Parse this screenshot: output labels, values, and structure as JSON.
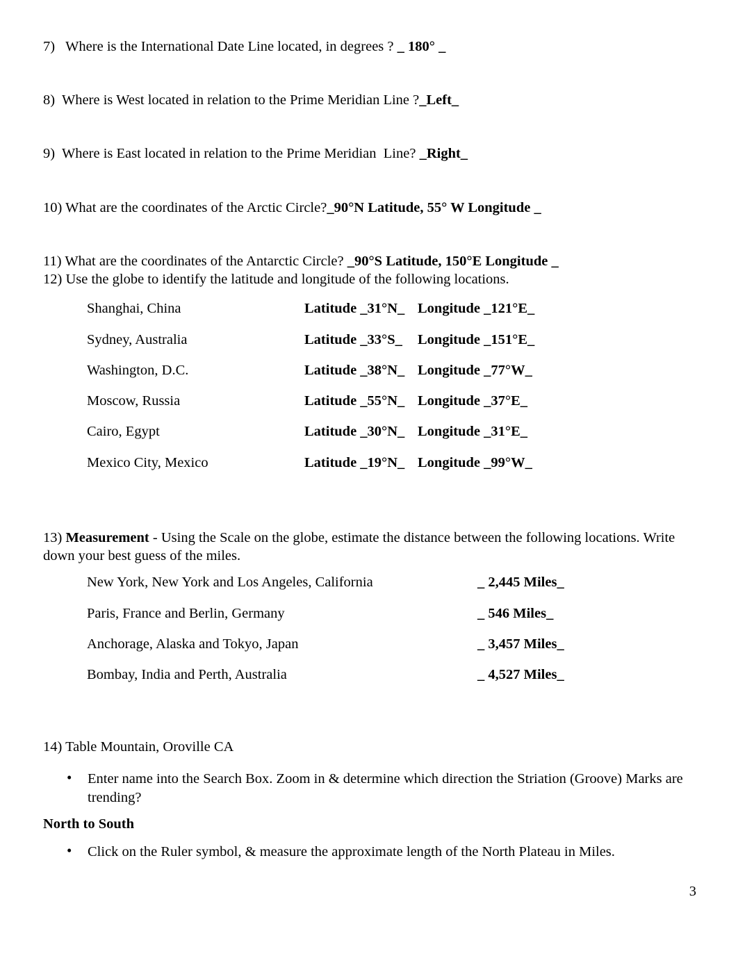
{
  "document": {
    "page_number": "3",
    "questions": [
      {
        "id": "q7",
        "prompt": "7)   Where is the International Date Line located, in degrees ? ",
        "answer": "_ 180° _"
      },
      {
        "id": "q8",
        "prompt": "8)  Where is West located in relation to the Prime Meridian Line ?",
        "answer": "_Left_"
      },
      {
        "id": "q9",
        "prompt": "9)  Where is East located in relation to the Prime Meridian  Line? ",
        "answer": "_Right_"
      },
      {
        "id": "q10",
        "prompt": "10) What are the coordinates of the Arctic Circle?",
        "answer": "_90°N Latitude, 55° W Longitude _"
      },
      {
        "id": "q11",
        "prompt": "11) What are the coordinates of the Antarctic Circle? ",
        "answer": "_90°S Latitude, 150°E Longitude _"
      }
    ],
    "q12": {
      "lead": "12) Use the globe to identify the latitude and longitude of the following locations.",
      "rows": [
        {
          "city": "Shanghai, China",
          "latitude": "Latitude _31°N_",
          "longitude": "Longitude _121°E_"
        },
        {
          "city": "Sydney, Australia",
          "latitude": "Latitude _33°S_",
          "longitude": "Longitude _151°E_"
        },
        {
          "city": "Washington, D.C.",
          "latitude": "Latitude _38°N_",
          "longitude": "Longitude _77°W_"
        },
        {
          "city": "Moscow, Russia",
          "latitude": "Latitude _55°N_",
          "longitude": "Longitude _37°E_"
        },
        {
          "city": "Cairo, Egypt",
          "latitude": "Latitude _30°N_",
          "longitude": "Longitude _31°E_"
        },
        {
          "city": "Mexico City, Mexico",
          "latitude": "Latitude _19°N_",
          "longitude": "Longitude _99°W_"
        }
      ]
    },
    "q13": {
      "number": "13) ",
      "label": "Measurement",
      "lead_rest": " - Using the Scale on the globe, estimate the distance between the following locations. Write down your best guess of the miles.",
      "rows": [
        {
          "pair": "New York, New York and Los Angeles, California",
          "miles": "_ 2,445 Miles_"
        },
        {
          "pair": "Paris, France and Berlin, Germany",
          "miles": "_ 546 Miles_"
        },
        {
          "pair": "Anchorage, Alaska and Tokyo, Japan",
          "miles": "_ 3,457 Miles_"
        },
        {
          "pair": "Bombay, India and Perth, Australia",
          "miles": "_ 4,527 Miles_"
        }
      ]
    },
    "q14": {
      "lead": "14) Table Mountain, Oroville CA",
      "bullet1": "Enter name into the Search Box. Zoom in & determine which direction the Striation (Groove) Marks are trending?",
      "answer1": "North to South",
      "bullet2": "Click on the Ruler symbol, & measure the approximate length of the North Plateau in Miles.",
      "bullet_glyph": "•"
    }
  }
}
